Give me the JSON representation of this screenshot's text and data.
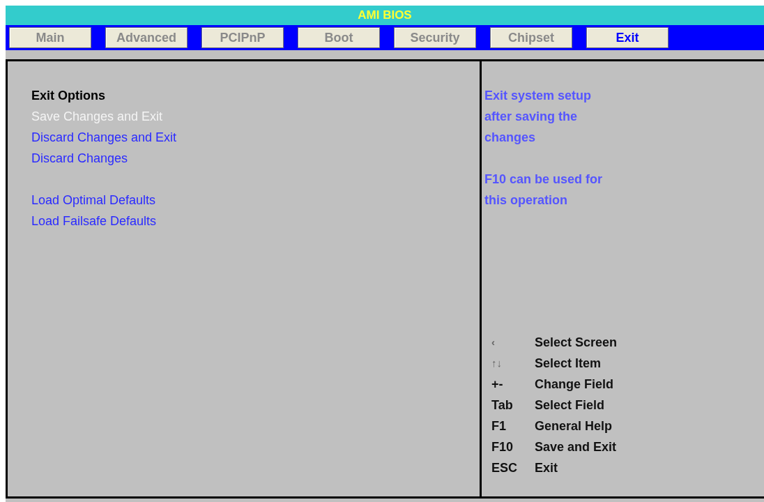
{
  "title": "AMI BIOS",
  "tabs": [
    {
      "label": "Main",
      "selected": false
    },
    {
      "label": "Advanced",
      "selected": false
    },
    {
      "label": "PCIPnP",
      "selected": false
    },
    {
      "label": "Boot",
      "selected": false
    },
    {
      "label": "Security",
      "selected": false
    },
    {
      "label": "Chipset",
      "selected": false
    },
    {
      "label": "Exit",
      "selected": true
    }
  ],
  "sections": [
    {
      "heading": "Exit Options",
      "items": [
        {
          "label": "Save Changes and Exit",
          "selected": true
        },
        {
          "label": "Discard Changes and Exit",
          "selected": false
        },
        {
          "label": "Discard Changes",
          "selected": false
        }
      ]
    },
    {
      "items": [
        {
          "label": "Load Optimal Defaults",
          "selected": false
        },
        {
          "label": "Load Failsafe Defaults",
          "selected": false
        }
      ]
    }
  ],
  "help": [
    [
      "Exit system setup",
      "after saving the",
      "changes"
    ],
    [
      "F10 can be used for",
      "this operation"
    ]
  ],
  "keys": [
    {
      "key": "‹",
      "action": "Select Screen",
      "kind": "arrow"
    },
    {
      "key": "↑↓",
      "action": "Select Item",
      "kind": "arrow"
    },
    {
      "key": "+-",
      "action": "Change Field",
      "kind": "text"
    },
    {
      "key": "Tab",
      "action": "Select Field",
      "kind": "text"
    },
    {
      "key": "F1",
      "action": "General Help",
      "kind": "text"
    },
    {
      "key": "F10",
      "action": "Save and Exit",
      "kind": "text"
    },
    {
      "key": "ESC",
      "action": "Exit",
      "kind": "text"
    }
  ]
}
